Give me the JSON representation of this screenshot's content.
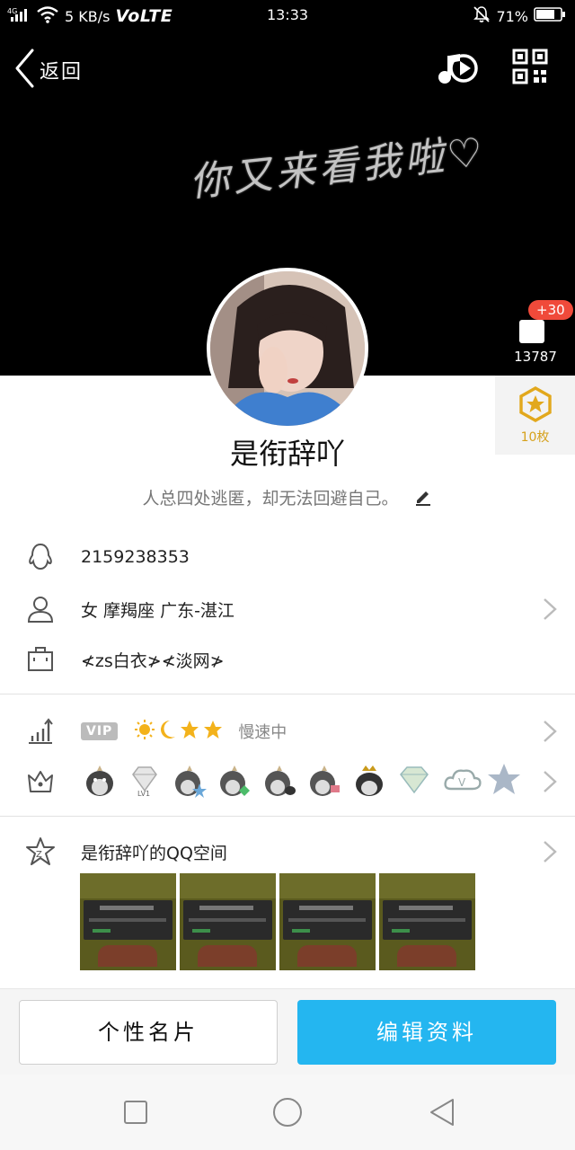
{
  "status_bar": {
    "network": "4G",
    "speed": "5 KB/s",
    "volte": "VoLTE",
    "time": "13:33",
    "battery": "71%"
  },
  "top_bar": {
    "back_label": "返回"
  },
  "banner": {
    "signature": "你又来看我啦♡"
  },
  "likes": {
    "badge": "+30",
    "count": "13787"
  },
  "medal": {
    "count": "10枚"
  },
  "profile": {
    "nickname": "是衔辞吖",
    "bio": "人总四处逃匿，却无法回避自己。"
  },
  "info": {
    "qq_number": "2159238353",
    "personal": "女  摩羯座  广东-湛江",
    "group": "≮zs白衣≯≮淡网≯"
  },
  "vip": {
    "label": "VIP",
    "speed_text": "慢速中"
  },
  "qzone": {
    "title": "是衔辞吖的QQ空间"
  },
  "buttons": {
    "card": "个性名片",
    "edit": "编辑资料"
  },
  "colors": {
    "accent": "#24b6f0",
    "badge_red": "#f04a3a",
    "medal_gold": "#e2a81c"
  }
}
